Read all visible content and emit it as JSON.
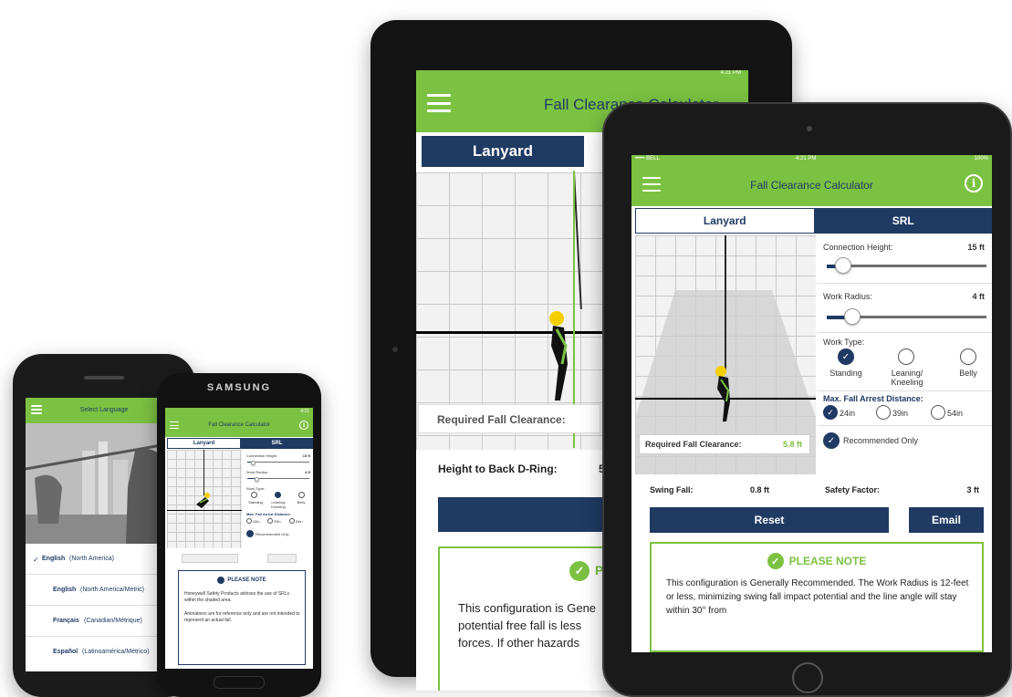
{
  "app": {
    "title": "Fall Clearance Calculator",
    "info_symbol": "i"
  },
  "tabs": {
    "lanyard": "Lanyard",
    "srl": "SRL"
  },
  "status": {
    "time_back": "4:21 PM",
    "time_front": "4:21 PM",
    "time_samsung": "4:21",
    "signal_front": "••••• BELL ",
    "battery_front": "100%"
  },
  "samsung_brand": "SAMSUNG",
  "controls": {
    "connection_height_label": "Connection Height:",
    "connection_height_value": "15 ft",
    "connection_height_level": 0.1,
    "work_radius_label": "Work Radius:",
    "work_radius_value": "4 ft",
    "work_radius_level": 0.16,
    "work_type_label": "Work Type:",
    "work_types": [
      "Standing",
      "Leaning/ Kneeling",
      "Belly"
    ],
    "work_type_selected": "Standing",
    "max_fall_label": "Max. Fall Arrest Distance:",
    "max_fall_options": [
      "24in",
      "39in",
      "54in"
    ],
    "max_fall_selected": "24in",
    "recommended_only": "Recommended Only"
  },
  "results": {
    "required_clearance_label": "Required Fall Clearance:",
    "required_clearance_value": "5.8 ft",
    "swing_fall_label": "Swing Fall:",
    "swing_fall_value": "0.8 ft",
    "safety_factor_label": "Safety Factor:",
    "safety_factor_value": "3 ft",
    "height_to_dring_label": "Height to Back D-Ring:",
    "height_to_dring_value": "5"
  },
  "buttons": {
    "reset": "Reset",
    "email": "Email"
  },
  "note": {
    "title": "PLEASE NOTE",
    "title_partial": "PL",
    "front_text": "This configuration is Generally Recommended.  The Work Radius is 12-feet or less, minimizing swing fall impact potential and the line angle will stay within 30° from",
    "back_text_1": "This configuration is Gene",
    "back_text_2": "potential free fall is less",
    "back_text_3": "forces. If other hazards",
    "samsung_text_1": "Honeywell Safety Products advises the use of SRLs within the shaded area.",
    "samsung_text_2": "Animations are for reference only and are not intended to represent an actual fall."
  },
  "language": {
    "title": "Select Language",
    "options": [
      {
        "name": "English",
        "region": "(North America)",
        "checked": true
      },
      {
        "name": "English",
        "region": "(North America/Metric)",
        "checked": false
      },
      {
        "name": "Français",
        "region": "(Canadian/Métrique)",
        "checked": false
      },
      {
        "name": "Español",
        "region": "(Latinoamérica/Métrico)",
        "checked": false
      }
    ],
    "check_symbol": "✓"
  },
  "colors": {
    "green": "#7cc242",
    "navy": "#1f3a63",
    "harness_yellow": "#f5d000"
  }
}
